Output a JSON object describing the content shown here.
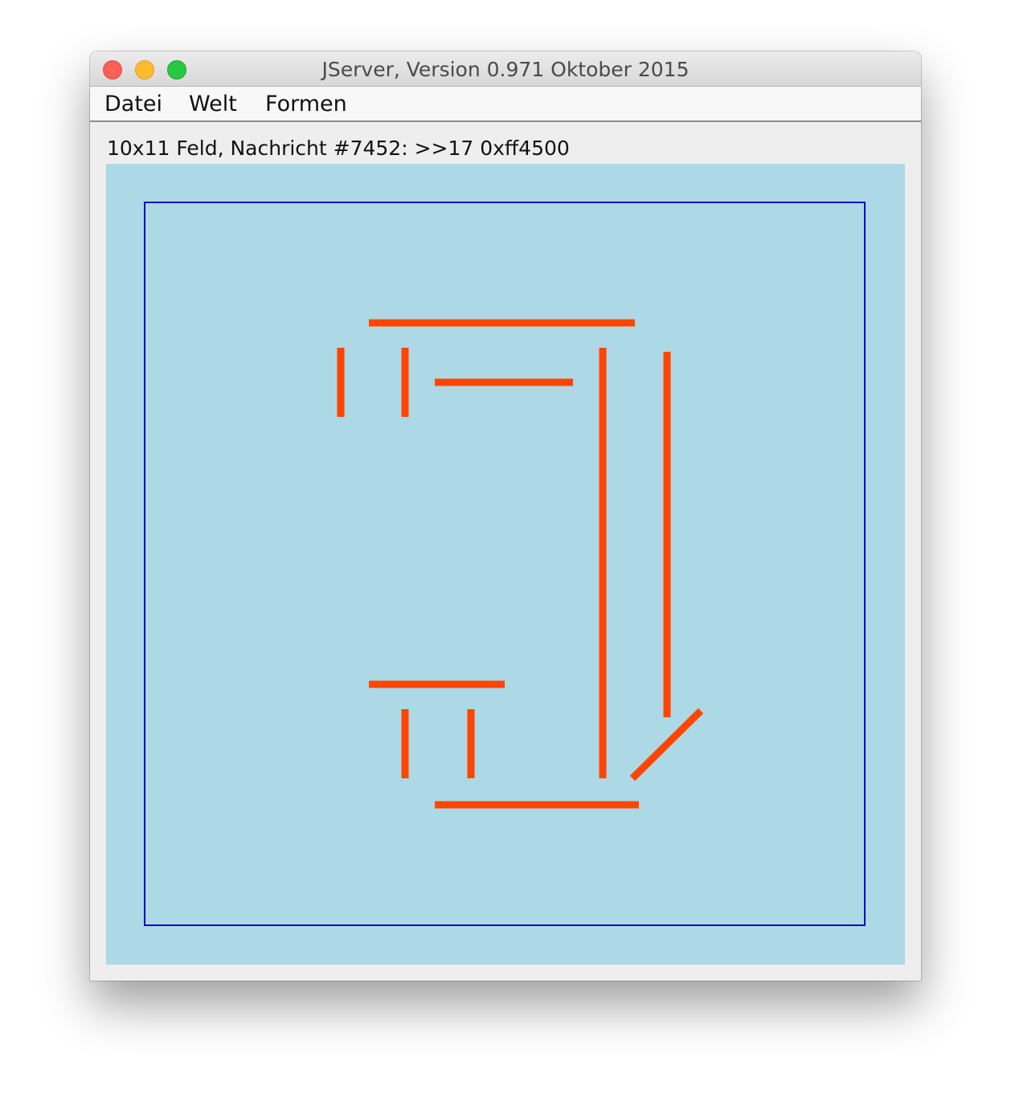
{
  "window": {
    "title": "JServer, Version 0.971 Oktober 2015"
  },
  "menu": {
    "items": [
      {
        "label": "Datei"
      },
      {
        "label": "Welt"
      },
      {
        "label": "Formen"
      }
    ]
  },
  "status": {
    "text": "10x11 Feld, Nachricht #7452: >>17 0xff4500"
  },
  "colors": {
    "field_background": "#add8e6",
    "border": "#0000cd",
    "stroke": "#ff4500"
  }
}
